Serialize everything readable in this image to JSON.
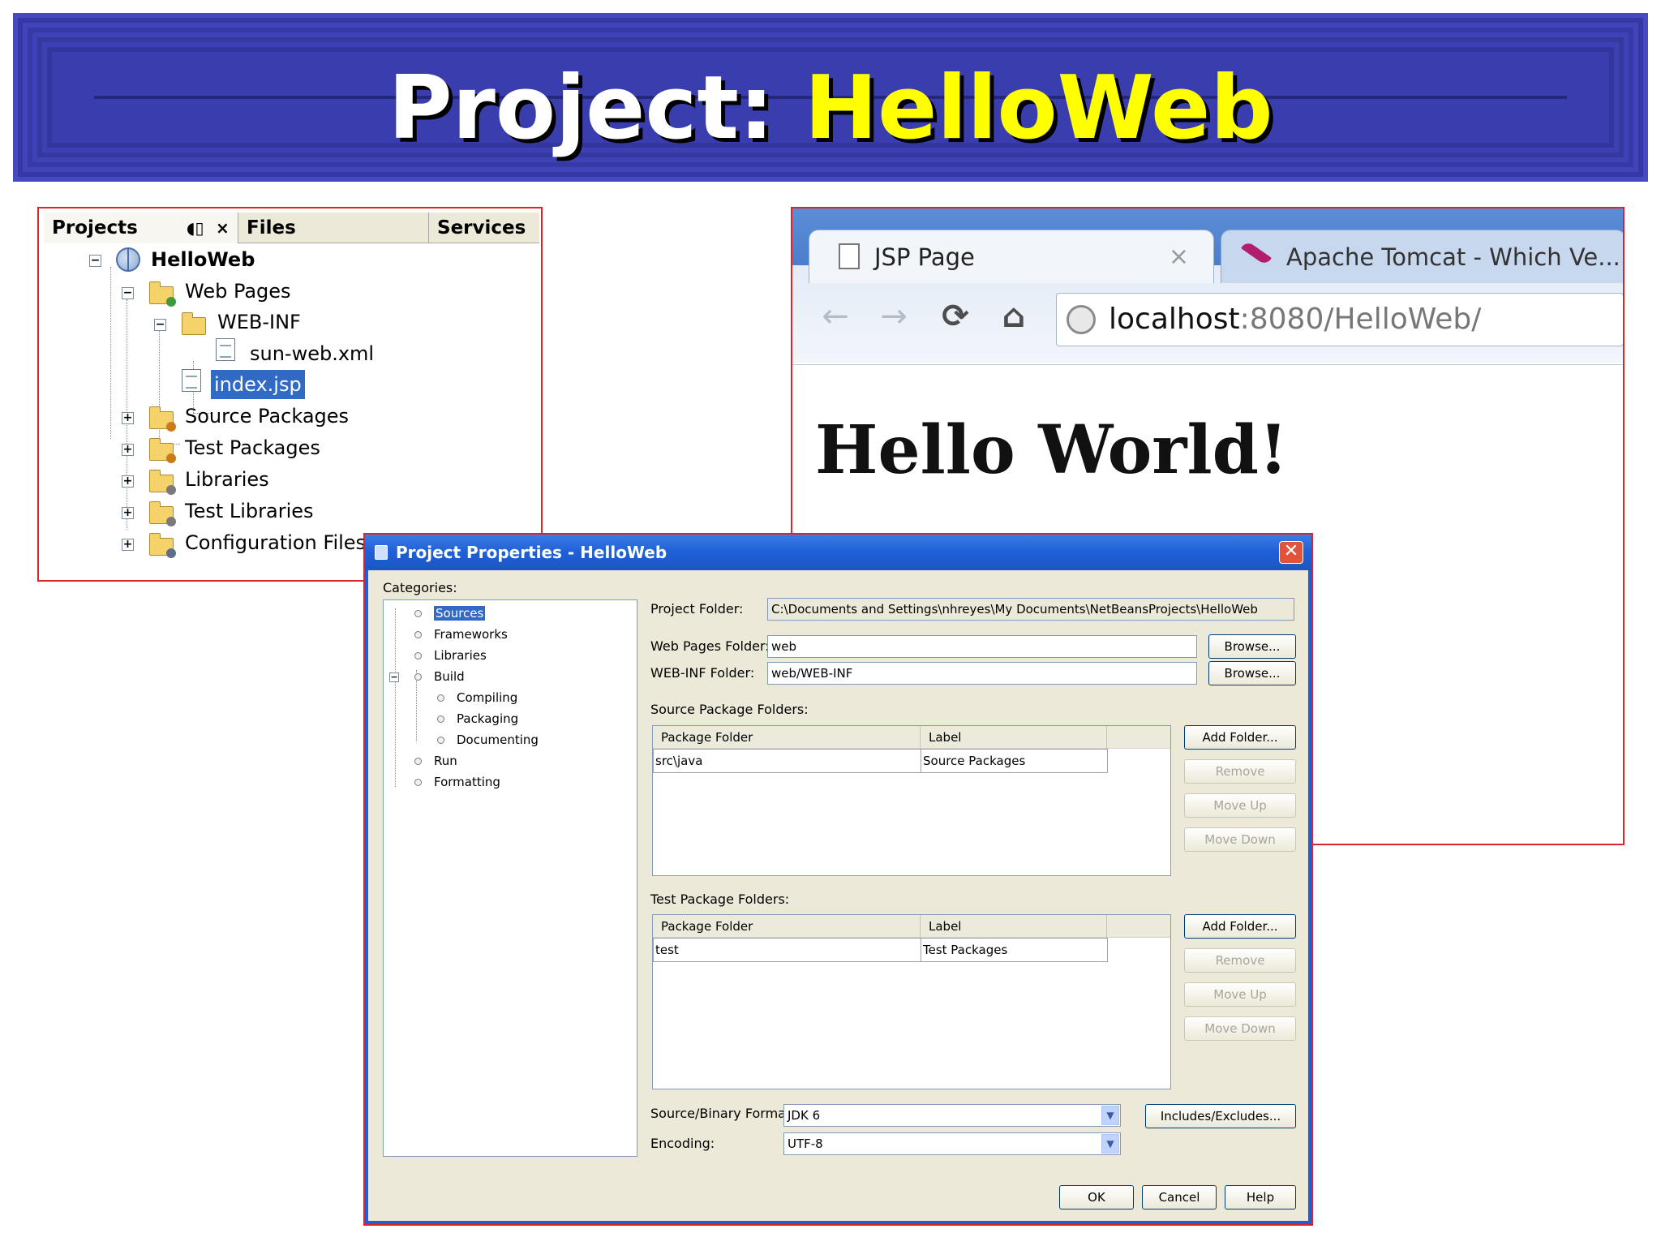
{
  "slide": {
    "title_prefix": "Project:",
    "title_name": "HelloWeb"
  },
  "projects_panel": {
    "tabs": [
      {
        "label": "Projects"
      },
      {
        "label": "Files"
      },
      {
        "label": "Services"
      }
    ],
    "minimize_icon": "◖▯",
    "close_icon": "×",
    "tree": [
      {
        "label": "HelloWeb",
        "icon": "globe-icon"
      },
      {
        "label": "Web Pages",
        "icon": "folder-icon"
      },
      {
        "label": "WEB-INF",
        "icon": "folder-icon"
      },
      {
        "label": "sun-web.xml",
        "icon": "xml-file-icon"
      },
      {
        "label": "index.jsp",
        "icon": "jsp-file-icon"
      },
      {
        "label": "Source Packages",
        "icon": "folder-icon"
      },
      {
        "label": "Test Packages",
        "icon": "folder-icon"
      },
      {
        "label": "Libraries",
        "icon": "folder-icon"
      },
      {
        "label": "Test Libraries",
        "icon": "folder-icon"
      },
      {
        "label": "Configuration Files",
        "icon": "folder-icon"
      }
    ]
  },
  "browser": {
    "tabs": [
      {
        "label": "JSP Page",
        "close": "×"
      },
      {
        "label": "Apache Tomcat - Which Ve..."
      }
    ],
    "nav": {
      "back": "←",
      "forward": "→",
      "reload": "⟳",
      "home": "⌂"
    },
    "url_host": "localhost",
    "url_rest": ":8080/HelloWeb/",
    "heading": "Hello World!"
  },
  "dialog": {
    "title": "Project Properties - HelloWeb",
    "close": "✕",
    "categories_label": "Categories:",
    "categories": [
      {
        "label": "Sources"
      },
      {
        "label": "Frameworks"
      },
      {
        "label": "Libraries"
      },
      {
        "label": "Build"
      },
      {
        "label": "Compiling"
      },
      {
        "label": "Packaging"
      },
      {
        "label": "Documenting"
      },
      {
        "label": "Run"
      },
      {
        "label": "Formatting"
      }
    ],
    "project_folder_label": "Project Folder:",
    "project_folder_value": "C:\\Documents and Settings\\nhreyes\\My Documents\\NetBeansProjects\\HelloWeb",
    "web_pages_folder_label": "Web Pages Folder:",
    "web_pages_folder_value": "web",
    "web_inf_folder_label": "WEB-INF Folder:",
    "web_inf_folder_value": "web/WEB-INF",
    "browse_label": "Browse...",
    "source_package_folders_label": "Source Package Folders:",
    "test_package_folders_label": "Test Package Folders:",
    "table_headers": [
      "Package Folder",
      "Label"
    ],
    "source_rows": [
      [
        "src\\java",
        "Source Packages"
      ]
    ],
    "test_rows": [
      [
        "test",
        "Test Packages"
      ]
    ],
    "add_folder_label": "Add Folder...",
    "remove_label": "Remove",
    "move_up_label": "Move Up",
    "move_down_label": "Move Down",
    "source_binary_format_label": "Source/Binary Format:",
    "source_binary_format_value": "JDK 6",
    "encoding_label": "Encoding:",
    "encoding_value": "UTF-8",
    "includes_excludes_label": "Includes/Excludes...",
    "ok_label": "OK",
    "cancel_label": "Cancel",
    "help_label": "Help",
    "dropdown_arrow": "▼"
  }
}
